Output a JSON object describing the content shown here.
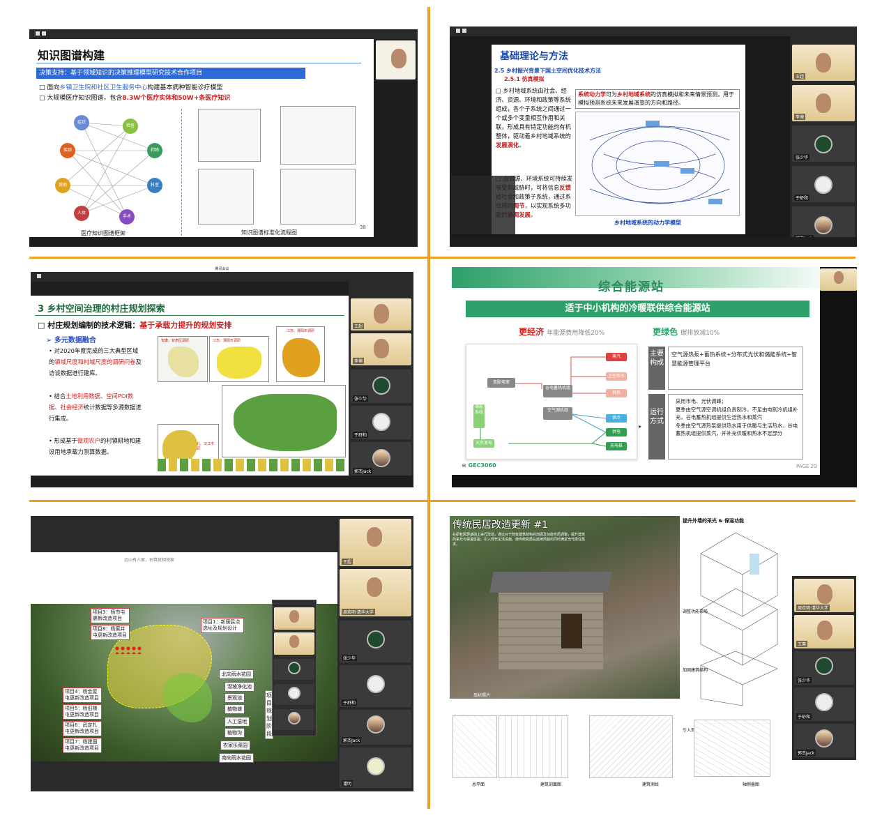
{
  "p1": {
    "heading": "知识图谱构建",
    "banner": "决策支持：基于领域知识的决策推理模型研究技术合作项目",
    "bullet1_a": "面向",
    "bullet1_b": "乡镇卫生院和社区卫生服务中心",
    "bullet1_c": "构建基本病种智能诊疗模型",
    "bullet2_a": "大规模医疗知识图谱，包含",
    "bullet2_b": "8.3W个医疗实体和50W+条医疗知识",
    "caption_left": "医疗知识图谱框架",
    "caption_right": "知识图谱标准化流程图",
    "page": "38",
    "nodes": [
      "症状",
      "药物",
      "检查",
      "疾病",
      "科室",
      "人体",
      "手术",
      "操作",
      "其他"
    ]
  },
  "p2": {
    "heading": "基础理论与方法",
    "sub1": "2.5 乡村振兴背景下国土空间优化技术方法",
    "sub2": "2.5.1 仿真模拟",
    "para1_a": "乡村地域系统由社会、经济、资源、环境和政策等系统组成，各个子系统之间通过一个或多个变量相互作用和关联，形成具有特定功能的有机整体，驱动着乡村地域系统的",
    "para1_b": "发展演化",
    "para1_c": "。",
    "para2_a": "当资源、环境系统可持续发展受到威胁时，可将信息",
    "para2_b": "反馈",
    "para2_c": "给社会和政策子系统，通过系统间的",
    "para2_d": "调节",
    "para2_e": "，以实现系统多功能的",
    "para2_f": "协调发展",
    "para2_g": "。",
    "box_a": "系统动力学",
    "box_b": "可为",
    "box_c": "乡村地域系统",
    "box_d": "的仿真模拟和未来情景预测，用于模拟预测系统未来发展演变的方向和路径。",
    "caption": "乡村地域系统的动力学模型"
  },
  "p3": {
    "window_title": "腾讯会议",
    "heading": "3 乡村空间治理的村庄规划探索",
    "point_a": "村庄规划编制的技术逻辑：",
    "point_b": "基于承载力提升的规划安排",
    "sub": "多元数据融合",
    "b1_a": "对2020年度完成的三大典型区域的",
    "b1_b": "镇域尺度和村域尺度的调研问卷",
    "b1_c": "及访谈数据进行建库。",
    "b2_a": "结合",
    "b2_b": "土地利用数据、空间POI数据、社会经济",
    "b2_c": "统计数据等多源数据进行集成。",
    "b3_a": "形成基于",
    "b3_b": "微观农户",
    "b3_c": "的村镇耕地和建设用地承载力测算数据。",
    "map1": "安康、甘肃区调研",
    "map2": "江苏、溧阳市调研",
    "map3": "江苏、溧阳市调研",
    "map4": "湖北、汉江市调研",
    "names": [
      "王超",
      "李博",
      "张少华",
      "于舒和",
      "郭杰Jack"
    ]
  },
  "p4": {
    "title": "综合能源站",
    "banner": "适于中小机构的冷暖联供综合能源站",
    "eco": "更经济",
    "eco_sub": "年能源费用降低20%",
    "green": "更绿色",
    "green_sub": "碳排放减10%",
    "main_label": "主要构成",
    "main_text": "空气源热泵+蓄热系统+分布式光伏和储能系统+智慧能源管理平台",
    "op_label": "运行方式",
    "op1": "采用市电、光伏调峰；",
    "op2": "夏季由空气源空调机组负责制冷，不足由电制冷机组补充，谷电蓄热机组提供生活热水和蒸汽",
    "op3": "冬季由空气源热泵提供热水用于供暖与生活热水，谷电蓄热机组提供蒸汽，并补充供暖和热水不足部分",
    "logo": "GEC3060",
    "page": "PAGE 29",
    "nodes": [
      "变配电室",
      "谷电蓄热机组",
      "空气源机组",
      "储能系统",
      "光伏发电",
      "蒸汽",
      "卫生热水",
      "供热",
      "供冷",
      "供电",
      "充电桩"
    ]
  },
  "p5": {
    "note": "远山有人家，石筑就相悦家",
    "projects": [
      "项目3：杨市屯裹新改造项目",
      "项目8：杨案井屯更新改造项目",
      "项目1：新居民点选址及规划设计",
      "项目4：杨金屋屯更新改造项目",
      "项目5：杨旧梯屯更新改造项目",
      "项目6：武定扎屯更新改造项目",
      "项目7：杨建国屯更新改造项目"
    ],
    "facilities": [
      "北向雨水花园",
      "潜坡净化池",
      "景观池",
      "植物塘",
      "人工湿地",
      "植物沟",
      "农家乐菜园",
      "南向雨水花园"
    ],
    "side_text": "项目规划阶段",
    "names": [
      "王超",
      "周欢明·清华大学",
      "张少华",
      "于舒和",
      "郭杰Jack",
      "潘明"
    ]
  },
  "p6": {
    "title": "传统民居改造更新 #1",
    "intro": "在原有民居基础上进行改造，通过对于既有建筑结构的加固及功能布局调整，提升建筑的采光与保温性能，引入现代生活设施，使传统民居在延续风貌的同时满足当代居住需求。",
    "photo_label": "现状照片",
    "top_label": "提升外墙的采光 & 保温功能",
    "mid1": "调整功能布局",
    "mid2": "加固建筑结构",
    "mid3": "引入现代设施",
    "bottom": [
      "总平面",
      "建筑剖面图",
      "建筑测绘",
      "轴侧叠图"
    ],
    "names": [
      "周欢明·清华大学",
      "王骞",
      "张少华",
      "于舒和",
      "郭杰Jack"
    ]
  },
  "colors": {
    "divider": "#f0a020",
    "green": "#2ea06a",
    "blue_banner": "#2d6ad6",
    "red": "#d32020"
  }
}
